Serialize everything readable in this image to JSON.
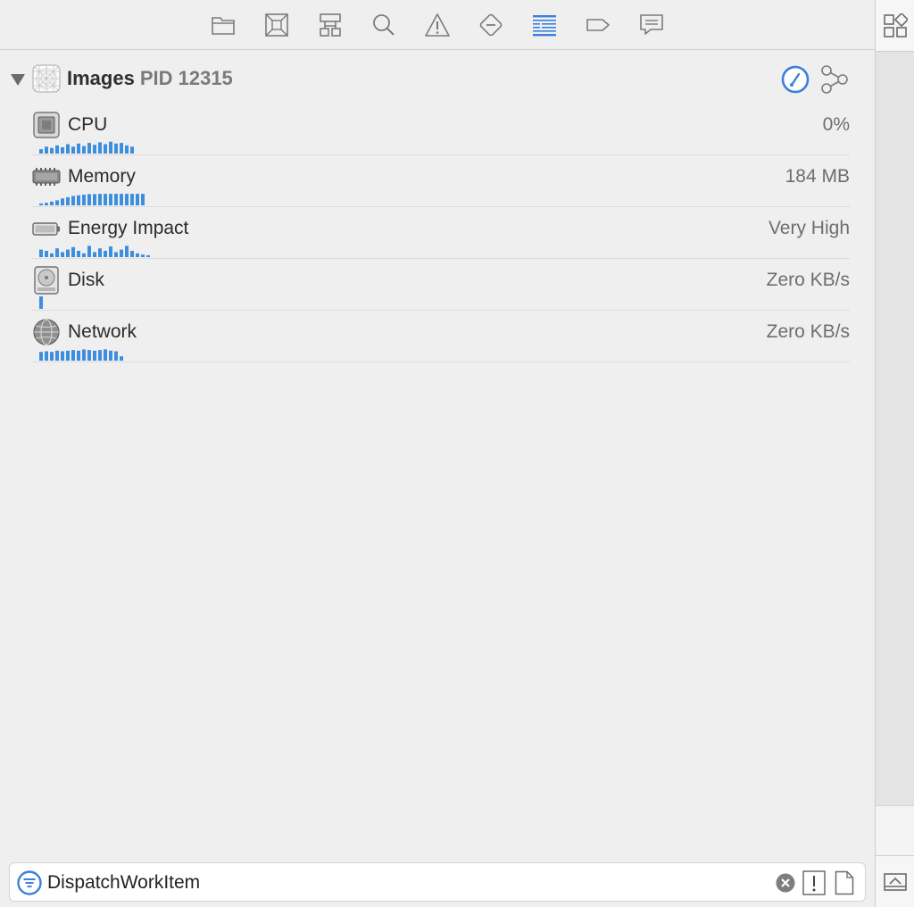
{
  "toolbar": {
    "buttons": [
      {
        "name": "project-navigator",
        "icon": "folder-icon",
        "selected": false
      },
      {
        "name": "source-control-navigator",
        "icon": "source-control-icon",
        "selected": false
      },
      {
        "name": "symbol-navigator",
        "icon": "hierarchy-icon",
        "selected": false
      },
      {
        "name": "find-navigator",
        "icon": "search-icon",
        "selected": false
      },
      {
        "name": "issue-navigator",
        "icon": "warning-icon",
        "selected": false
      },
      {
        "name": "test-navigator",
        "icon": "test-diamond-icon",
        "selected": false
      },
      {
        "name": "debug-navigator",
        "icon": "debug-list-icon",
        "selected": true
      },
      {
        "name": "breakpoint-navigator",
        "icon": "breakpoint-icon",
        "selected": false
      },
      {
        "name": "report-navigator",
        "icon": "report-bubble-icon",
        "selected": false
      }
    ],
    "selected_color": "#3a80dc",
    "icon_color": "#7b7b7b"
  },
  "process": {
    "name": "Images",
    "pid_label": "PID 12315",
    "icon": "app-icon",
    "gauge_color": "#3a80dc"
  },
  "gauges": [
    {
      "label": "CPU",
      "value": "0%",
      "icon": "cpu-chip-icon",
      "sparkline": [
        0.35,
        0.55,
        0.45,
        0.65,
        0.5,
        0.75,
        0.55,
        0.8,
        0.6,
        0.85,
        0.7,
        0.9,
        0.75,
        0.95,
        0.8,
        0.85,
        0.65,
        0.55
      ]
    },
    {
      "label": "Memory",
      "value": "184 MB",
      "icon": "memory-chip-icon",
      "sparkline": [
        0.15,
        0.2,
        0.3,
        0.4,
        0.55,
        0.65,
        0.75,
        0.8,
        0.85,
        0.9,
        0.9,
        0.92,
        0.92,
        0.92,
        0.92,
        0.92,
        0.92,
        0.92,
        0.92,
        0.92
      ]
    },
    {
      "label": "Energy Impact",
      "value": "Very High",
      "icon": "battery-icon",
      "sparkline": [
        0.6,
        0.5,
        0.3,
        0.7,
        0.4,
        0.6,
        0.8,
        0.5,
        0.3,
        0.9,
        0.4,
        0.7,
        0.5,
        0.85,
        0.4,
        0.6,
        0.9,
        0.5,
        0.3,
        0.2,
        0.15
      ]
    },
    {
      "label": "Disk",
      "value": "Zero KB/s",
      "icon": "disk-drive-icon",
      "sparkline": [
        1.0
      ]
    },
    {
      "label": "Network",
      "value": "Zero KB/s",
      "icon": "network-globe-icon",
      "sparkline": [
        0.7,
        0.75,
        0.7,
        0.8,
        0.75,
        0.8,
        0.85,
        0.8,
        0.9,
        0.85,
        0.8,
        0.85,
        0.9,
        0.8,
        0.75,
        0.35
      ]
    }
  ],
  "filter": {
    "value": "DispatchWorkItem",
    "icon": "filter-icon",
    "clear_icon": "clear-circle-icon",
    "issues_icon": "issue-filter-icon",
    "document_icon": "document-icon"
  },
  "sparkline_color": "#3d8fde"
}
